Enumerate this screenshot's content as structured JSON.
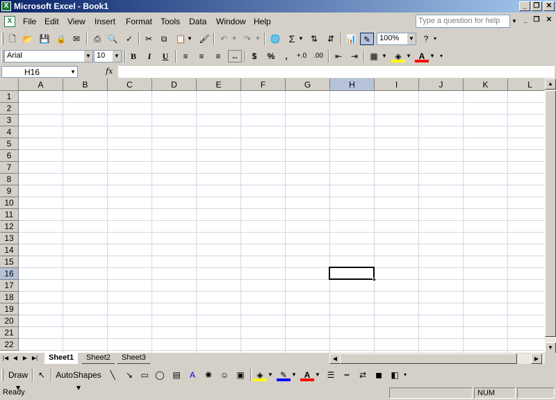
{
  "window": {
    "title": "Microsoft Excel - Book1",
    "app_icon": "X"
  },
  "menus": [
    "File",
    "Edit",
    "View",
    "Insert",
    "Format",
    "Tools",
    "Data",
    "Window",
    "Help"
  ],
  "help_search": {
    "placeholder": "Type a question for help"
  },
  "standard_toolbar": {
    "zoom": "100%"
  },
  "formatting_toolbar": {
    "font": "Arial",
    "size": "10",
    "bold": "B",
    "italic": "I",
    "underline": "U",
    "currency": "$",
    "percent": "%",
    "comma": ","
  },
  "formula_bar": {
    "name_box": "H16",
    "fx": "fx",
    "value": ""
  },
  "grid": {
    "columns": [
      "A",
      "B",
      "C",
      "D",
      "E",
      "F",
      "G",
      "H",
      "I",
      "J",
      "K",
      "L"
    ],
    "rows": [
      "1",
      "2",
      "3",
      "4",
      "5",
      "6",
      "7",
      "8",
      "9",
      "10",
      "11",
      "12",
      "13",
      "14",
      "15",
      "16",
      "17",
      "18",
      "19",
      "20",
      "21",
      "22"
    ],
    "active_cell": "H16"
  },
  "sheet_tabs": [
    "Sheet1",
    "Sheet2",
    "Sheet3"
  ],
  "drawing_toolbar": {
    "draw": "Draw",
    "autoshapes": "AutoShapes"
  },
  "status_bar": {
    "status": "Ready",
    "num": "NUM"
  },
  "colors": {
    "title_start": "#0a246a",
    "title_end": "#a6caf0",
    "selected_header": "#b6c2d8",
    "gridline": "#d0d7e5"
  }
}
